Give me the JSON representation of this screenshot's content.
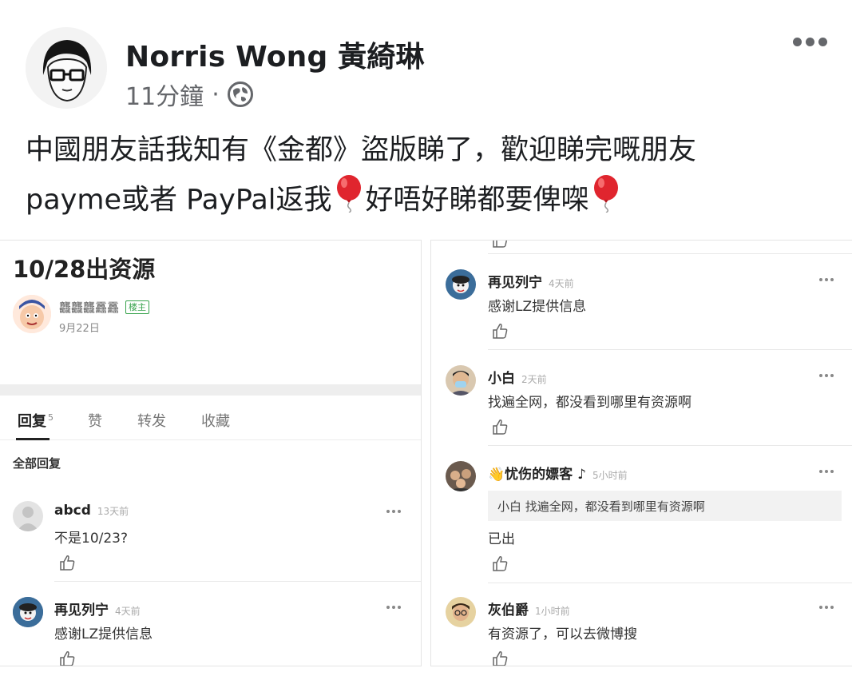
{
  "post": {
    "author": "Norris Wong 黃綺琳",
    "time": "11分鐘",
    "separator": "·",
    "line1": "中國朋友話我知有《金都》盜版睇了，歡迎睇完嘅朋友",
    "line2_a": "payme或者 PayPal返我",
    "line2_b": "好唔好睇都要俾㗎",
    "icons": [
      "globe-icon",
      "more-options-icon",
      "red-balloon-emoji"
    ]
  },
  "left_panel": {
    "title": "10/28出资源",
    "op": {
      "name": "龘龘龘靐靐",
      "badge": "楼主",
      "date": "9月22日"
    },
    "tabs": [
      {
        "label": "回复",
        "count": "5"
      },
      {
        "label": "赞"
      },
      {
        "label": "转发"
      },
      {
        "label": "收藏"
      }
    ],
    "all_replies": "全部回复",
    "comments": [
      {
        "name": "abcd",
        "time": "13天前",
        "body": "不是10/23?"
      },
      {
        "name": "再见列宁",
        "time": "4天前",
        "body": "感谢LZ提供信息"
      }
    ]
  },
  "right_panel": {
    "comments": [
      {
        "name": "再见列宁",
        "time": "4天前",
        "body": "感谢LZ提供信息"
      },
      {
        "name": "小白",
        "time": "2天前",
        "body": "找遍全网，都没看到哪里有资源啊"
      },
      {
        "name": "👋忧伤的嫖客 ♪",
        "time": "5小时前",
        "quote": "小白 找遍全网，都没看到哪里有资源啊",
        "body": "已出"
      },
      {
        "name": "灰伯爵",
        "time": "1小时前",
        "body": "有资源了，可以去微博搜"
      }
    ]
  },
  "colors": {
    "balloon": "#e0252e",
    "meta_gray": "#65676b",
    "badge_green": "#38a34d"
  }
}
